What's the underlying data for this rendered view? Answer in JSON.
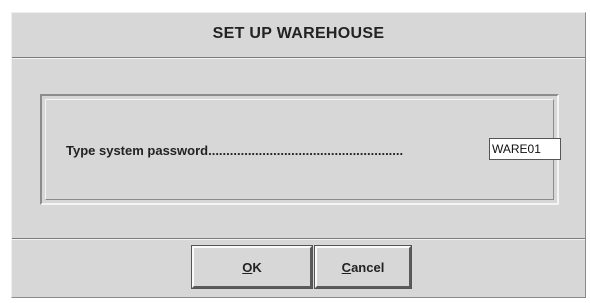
{
  "dialog": {
    "title": "SET UP WAREHOUSE",
    "prompt_label": "Type system password......................................................",
    "password_value": "WARE01",
    "ok_button": {
      "mnemonic": "O",
      "rest": "K"
    },
    "cancel_button": {
      "mnemonic": "C",
      "rest": "ancel"
    }
  }
}
